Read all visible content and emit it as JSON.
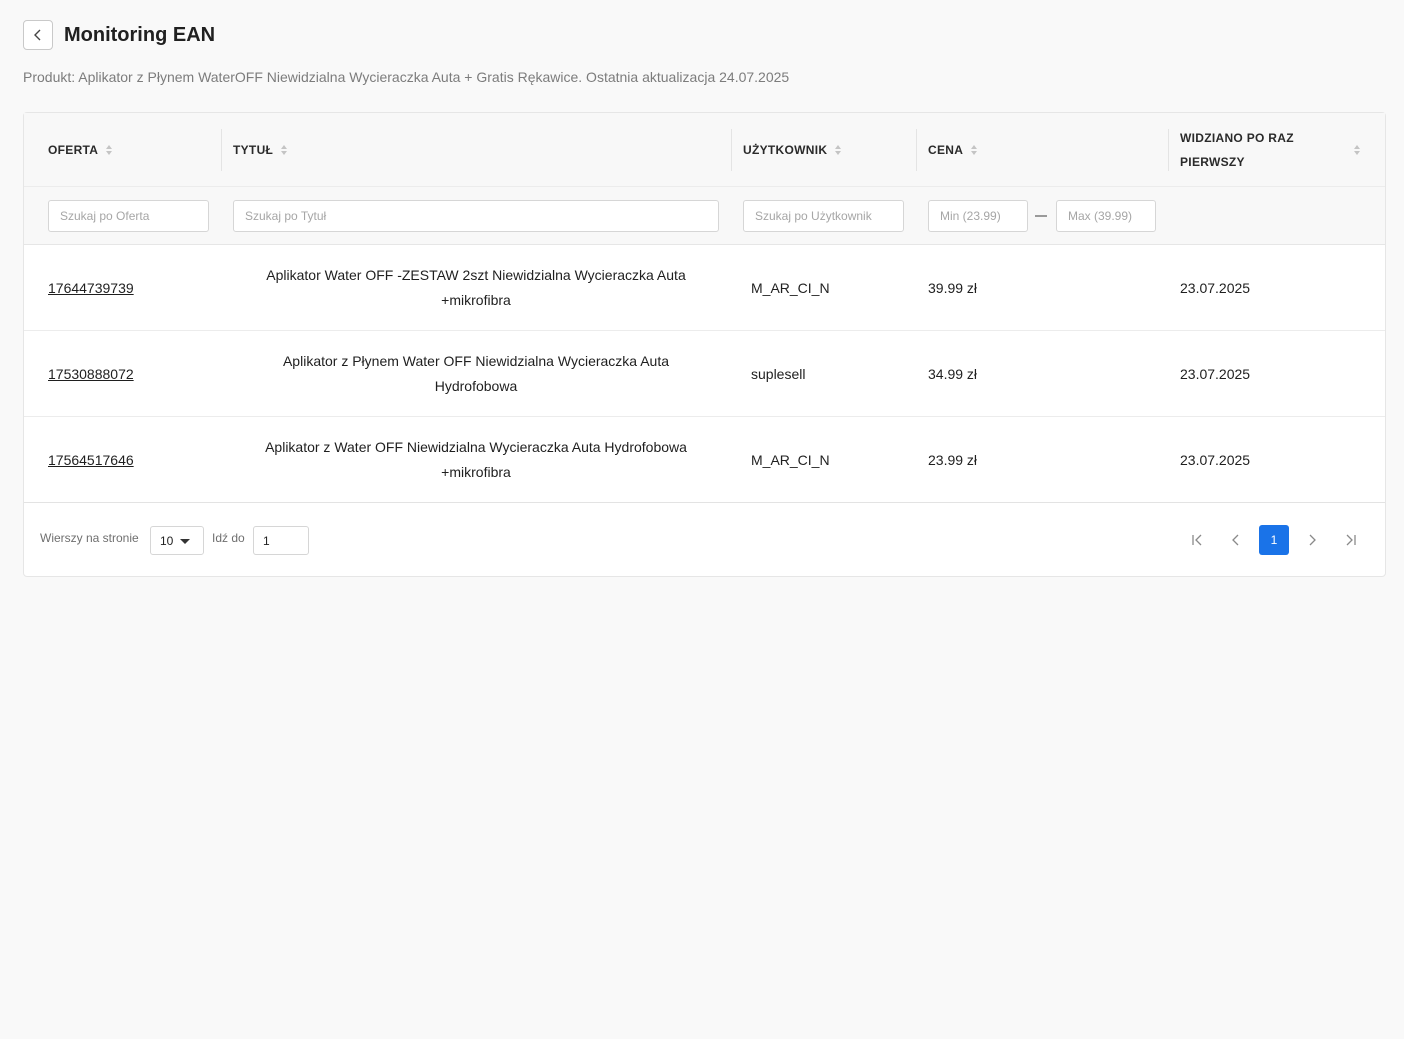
{
  "header": {
    "title": "Monitoring EAN",
    "subtitle": "Produkt: Aplikator z Płynem WaterOFF Niewidzialna Wycieraczka Auta + Gratis Rękawice. Ostatnia aktualizacja 24.07.2025"
  },
  "table": {
    "columns": {
      "offer": "OFERTA",
      "title": "TYTUŁ",
      "user": "UŻYTKOWNIK",
      "price": "CENA",
      "first_seen_line1": "WIDZIANO PO RAZ",
      "first_seen_line2": "PIERWSZY"
    },
    "filters": {
      "offer_placeholder": "Szukaj po Oferta",
      "title_placeholder": "Szukaj po Tytuł",
      "user_placeholder": "Szukaj po Użytkownik",
      "price_min_placeholder": "Min (23.99)",
      "price_max_placeholder": "Max (39.99)"
    },
    "rows": [
      {
        "offer": "17644739739",
        "title_line1": "Aplikator Water OFF -ZESTAW 2szt Niewidzialna Wycieraczka Auta",
        "title_line2": "+mikrofibra",
        "user": "M_AR_CI_N",
        "price": "39.99 zł",
        "first_seen": "23.07.2025"
      },
      {
        "offer": "17530888072",
        "title_line1": "Aplikator z Płynem Water OFF Niewidzialna Wycieraczka Auta",
        "title_line2": "Hydrofobowa",
        "user": "suplesell",
        "price": "34.99 zł",
        "first_seen": "23.07.2025"
      },
      {
        "offer": "17564517646",
        "title_line1": "Aplikator z Water OFF Niewidzialna Wycieraczka Auta Hydrofobowa",
        "title_line2": "+mikrofibra",
        "user": "M_AR_CI_N",
        "price": "23.99 zł",
        "first_seen": "23.07.2025"
      }
    ]
  },
  "pagination": {
    "rows_per_page_label": "Wierszy na stronie",
    "rows_per_page_value": "10",
    "goto_label": "Idź do",
    "goto_value": "1",
    "current_page": "1"
  },
  "colors": {
    "accent": "#1a73e8",
    "background": "#f9f9f9"
  },
  "icons": [
    "chevron-left-icon",
    "sort-icon",
    "caret-down-icon",
    "first-page-icon",
    "prev-page-icon",
    "next-page-icon",
    "last-page-icon"
  ]
}
